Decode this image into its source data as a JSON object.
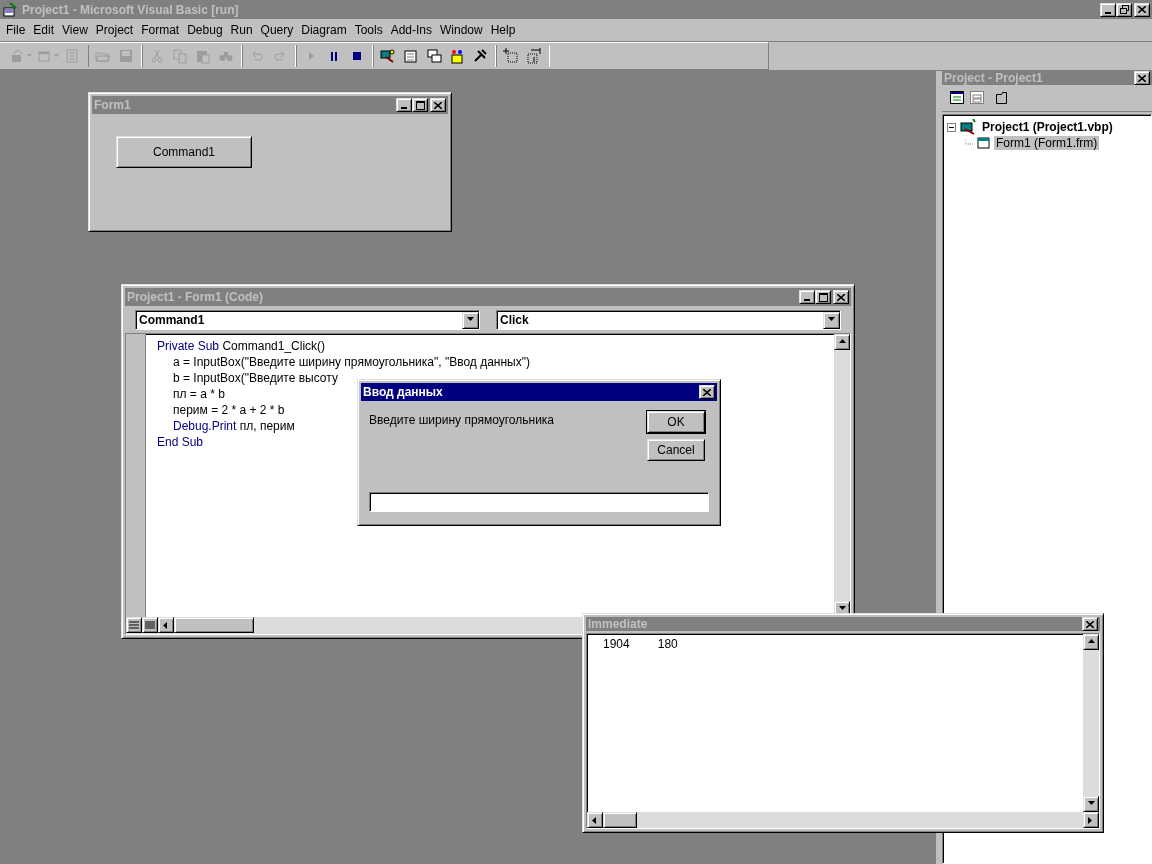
{
  "window": {
    "title": "Project1 - Microsoft Visual Basic [run]",
    "active": false
  },
  "menu": [
    "File",
    "Edit",
    "View",
    "Project",
    "Format",
    "Debug",
    "Run",
    "Query",
    "Diagram",
    "Tools",
    "Add-Ins",
    "Window",
    "Help"
  ],
  "toolbar": [
    [
      {
        "kind": "add-project",
        "disabled": true,
        "dropdown": true
      },
      {
        "kind": "add-form",
        "disabled": true,
        "dropdown": true
      },
      {
        "kind": "menu-editor",
        "disabled": true,
        "dropdown": false
      }
    ],
    [
      {
        "kind": "open",
        "disabled": true,
        "dropdown": false
      },
      {
        "kind": "save",
        "disabled": true,
        "dropdown": false
      }
    ],
    [
      {
        "kind": "cut",
        "disabled": true,
        "dropdown": false
      },
      {
        "kind": "copy",
        "disabled": true,
        "dropdown": false
      },
      {
        "kind": "paste",
        "disabled": true,
        "dropdown": false
      },
      {
        "kind": "find",
        "disabled": true,
        "dropdown": false
      }
    ],
    [
      {
        "kind": "undo",
        "disabled": true,
        "dropdown": false
      },
      {
        "kind": "redo",
        "disabled": true,
        "dropdown": false
      }
    ],
    [
      {
        "kind": "run",
        "disabled": true,
        "dropdown": false
      },
      {
        "kind": "pause",
        "disabled": false,
        "dropdown": false
      },
      {
        "kind": "stop",
        "disabled": false,
        "dropdown": false
      }
    ],
    [
      {
        "kind": "project-explorer",
        "disabled": false,
        "dropdown": false
      },
      {
        "kind": "properties",
        "disabled": false,
        "dropdown": false
      },
      {
        "kind": "form-layout",
        "disabled": false,
        "dropdown": false
      },
      {
        "kind": "object-browser",
        "disabled": false,
        "dropdown": false
      },
      {
        "kind": "toolbox",
        "disabled": false,
        "dropdown": false
      }
    ],
    [
      {
        "kind": "position",
        "disabled": false,
        "dropdown": false
      },
      {
        "kind": "size",
        "disabled": false,
        "dropdown": false
      }
    ]
  ],
  "form_window": {
    "title": "Form1",
    "active": false,
    "button": "Command1"
  },
  "code_window": {
    "title": "Project1 - Form1 (Code)",
    "active": false,
    "object": "Command1",
    "procedure": "Click",
    "header": [
      {
        "text": "Private Sub",
        "kind": "keyword"
      },
      {
        "text": " Command1_Click()",
        "kind": "plain"
      }
    ],
    "body": [
      [
        {
          "text": "a = InputBox(\"Введите ширину прямоугольника\", \"Ввод данных\")",
          "kind": "plain"
        }
      ],
      [
        {
          "text": "b = InputBox(\"Введите высоту",
          "kind": "plain"
        }
      ],
      [
        {
          "text": "пл = a * b",
          "kind": "plain"
        }
      ],
      [
        {
          "text": "перим = 2 * a + 2 * b",
          "kind": "plain"
        }
      ],
      [
        {
          "text": "Debug.Print",
          "kind": "keyword"
        },
        {
          "text": " пл, перим",
          "kind": "plain"
        }
      ]
    ],
    "footer": [
      {
        "text": "End Sub",
        "kind": "keyword"
      }
    ]
  },
  "dialog": {
    "title": "Ввод данных",
    "active": true,
    "prompt": "Введите ширину прямоугольника",
    "buttons": [
      {
        "label": "OK",
        "default": true
      },
      {
        "label": "Cancel",
        "default": false
      }
    ]
  },
  "project_panel": {
    "title": "Project - Project1",
    "active": false,
    "tree": [
      {
        "label": "Project1 (Project1.vbp)",
        "expanded": true,
        "selected": false,
        "children": [
          {
            "label": "Form1 (Form1.frm)",
            "selected": true
          }
        ]
      }
    ]
  },
  "immediate": {
    "title": "Immediate",
    "active": false,
    "lines": [
      [
        "1904",
        "180"
      ]
    ]
  }
}
